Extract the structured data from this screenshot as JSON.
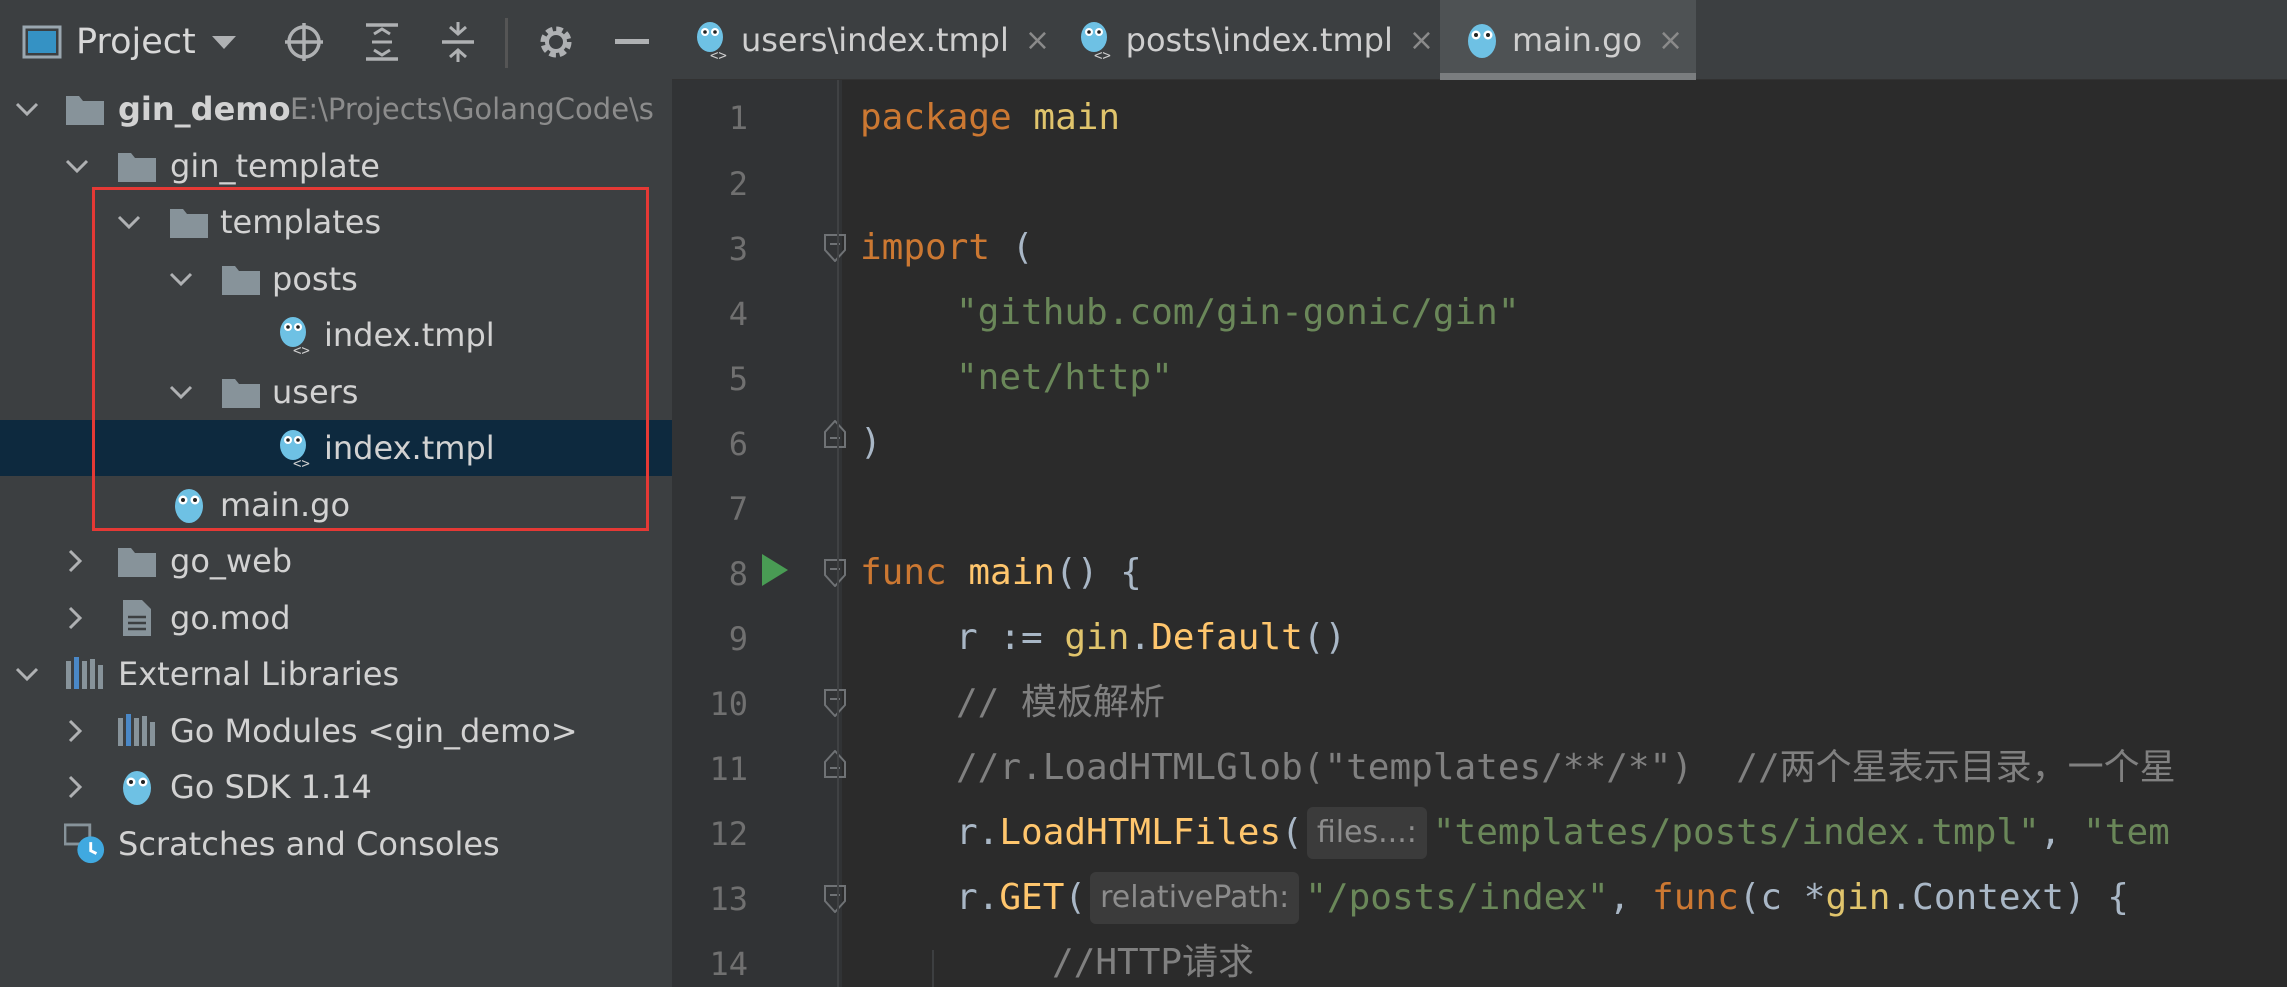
{
  "panel": {
    "title": "Project"
  },
  "tree": {
    "root_name": "gin_demo",
    "root_path": "E:\\Projects\\GolangCode\\s",
    "gin_template": "gin_template",
    "templates": "templates",
    "posts": "posts",
    "posts_index": "index.tmpl",
    "users": "users",
    "users_index": "index.tmpl",
    "main_go": "main.go",
    "go_web": "go_web",
    "go_mod": "go.mod",
    "external_libraries": "External Libraries",
    "go_modules": "Go Modules <gin_demo>",
    "go_sdk": "Go SDK 1.14",
    "scratches": "Scratches and Consoles"
  },
  "tabs": [
    {
      "label": "users\\index.tmpl",
      "close": "×"
    },
    {
      "label": "posts\\index.tmpl",
      "close": "×"
    },
    {
      "label": "main.go",
      "close": "×"
    }
  ],
  "line_numbers": [
    "1",
    "2",
    "3",
    "4",
    "5",
    "6",
    "7",
    "8",
    "9",
    "10",
    "11",
    "12",
    "13",
    "14"
  ],
  "code": {
    "l1_kw": "package",
    "l1_name": " main",
    "l3_kw": "import",
    "l3_rest": " (",
    "l4": "\"github.com/gin-gonic/gin\"",
    "l5": "\"net/http\"",
    "l6": ")",
    "l8_kw": "func",
    "l8_fn": " main",
    "l8_rest": "() {",
    "l9_a": "r := ",
    "l9_pkg": "gin",
    "l9_b": ".",
    "l9_fn": "Default",
    "l9_c": "()",
    "l10": "// 模板解析",
    "l11_a": "//r.LoadHTMLGlob(\"templates/**/*\")",
    "l11_b": "  //两个星表示目录，一个星",
    "l12_a": "r.",
    "l12_fn": "LoadHTMLFiles",
    "l12_b": "(",
    "l12_hint": "files...:",
    "l12_s1": "\"templates/posts/index.tmpl\"",
    "l12_c": ", ",
    "l12_s2": "\"tem",
    "l13_a": "r.",
    "l13_fn": "GET",
    "l13_b": "(",
    "l13_hint": "relativePath:",
    "l13_s": "\"/posts/index\"",
    "l13_c": ", ",
    "l13_kw": "func",
    "l13_d": "(c *",
    "l13_pkg": "gin",
    "l13_e": ".",
    "l13_type": "Context",
    "l13_f": ") {",
    "l14": "//HTTP请求"
  }
}
